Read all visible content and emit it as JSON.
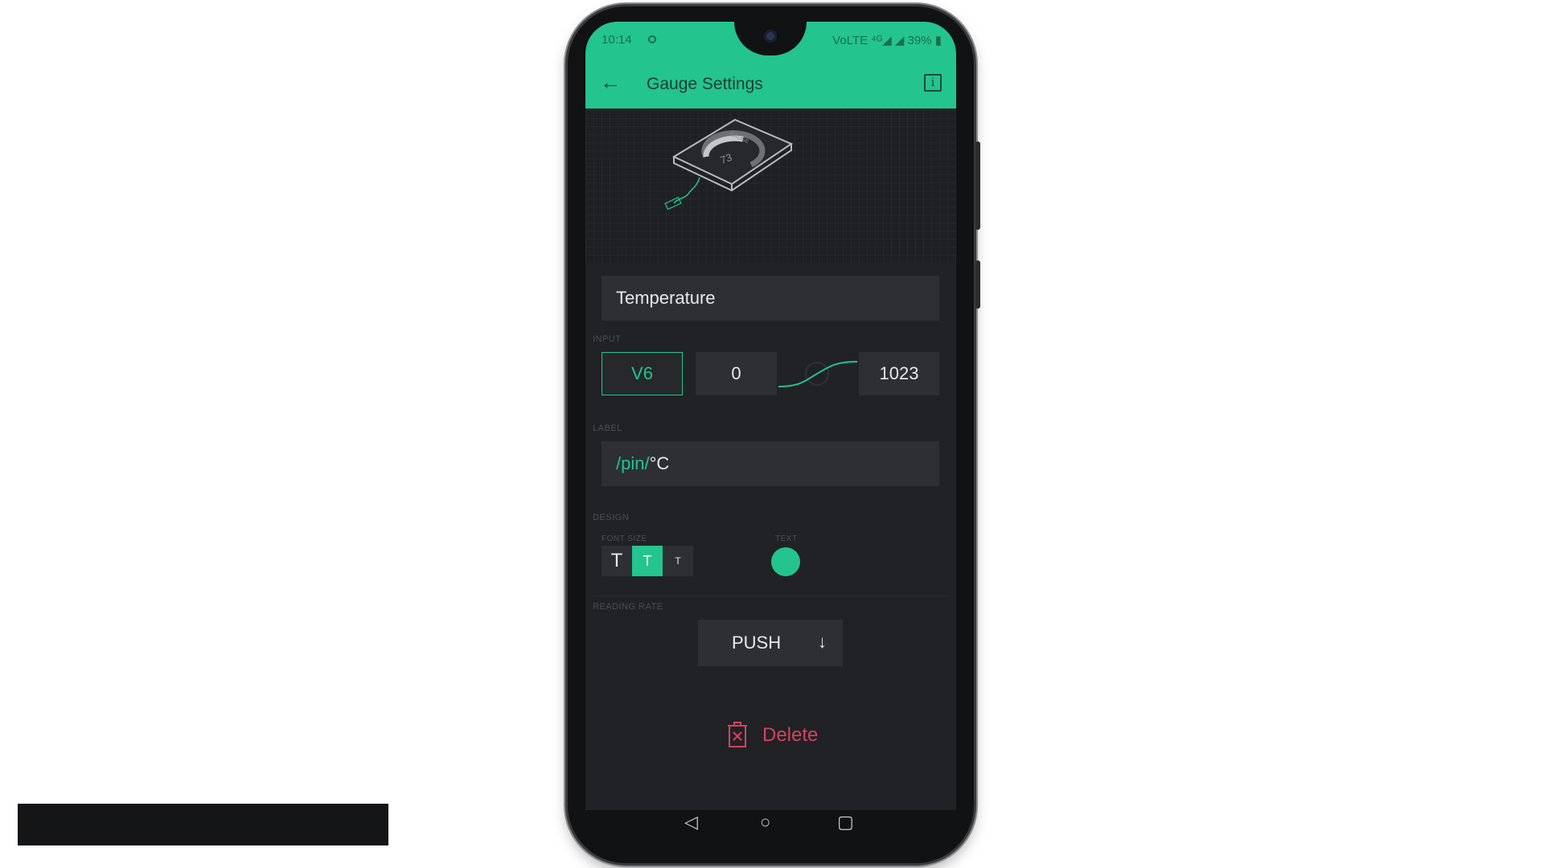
{
  "status_bar": {
    "time": "10:14",
    "icons_text": "VoLTE ⁴ᴳ◢ ◢ 39% ▮"
  },
  "app_bar": {
    "title": "Gauge Settings"
  },
  "hero": {
    "gauge_value": "73",
    "gauge_label": "GAUGE"
  },
  "widget_name": {
    "value": "Temperature"
  },
  "input_section": {
    "label": "INPUT",
    "pin": "V6",
    "min": "0",
    "max": "1023"
  },
  "label_section": {
    "label": "LABEL",
    "value_prefix": "/pin/",
    "value_suffix": "°C"
  },
  "design_section": {
    "label": "DESIGN",
    "font_size_label": "FONT SIZE",
    "font_sizes": [
      "T",
      "T",
      "T"
    ],
    "selected_font_index": 1,
    "text_color_label": "TEXT",
    "text_color": "#23c48e"
  },
  "reading_rate": {
    "label": "READING RATE",
    "value": "PUSH"
  },
  "delete": {
    "label": "Delete"
  },
  "colors": {
    "accent": "#23c48e",
    "danger": "#d3435c",
    "background": "#202226",
    "field": "#2d2f34"
  },
  "icons": {
    "back": "arrow-left-icon",
    "info": "info-icon",
    "dropdown": "arrow-down-icon",
    "delete": "trash-icon"
  }
}
